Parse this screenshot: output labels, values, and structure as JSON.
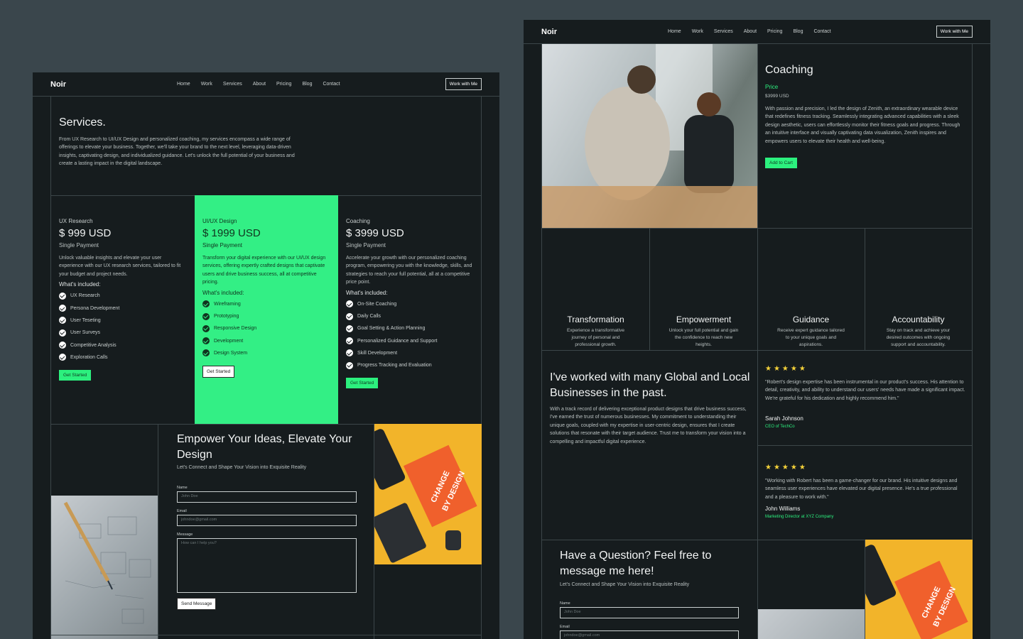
{
  "nav": {
    "logo": "Noir",
    "links": [
      "Home",
      "Work",
      "Services",
      "About",
      "Pricing",
      "Blog",
      "Contact"
    ],
    "cta": "Work with Me"
  },
  "services": {
    "title": "Services.",
    "intro": "From UX Research to UI/UX Design and personalized coaching, my services encompass a wide range of offerings to elevate your business. Together, we'll take your brand to the next level, leveraging data-driven insights, captivating design, and individualized guidance. Let's unlock the full potential of your business and create a lasting impact in the digital landscape.",
    "cards": [
      {
        "category": "UX Research",
        "price": "$ 999 USD",
        "payment": "Single Payment",
        "desc": "Unlock valuable insights and elevate your user experience with our UX research services, tailored to fit your budget and project needs.",
        "included": "What's included:",
        "items": [
          "UX Research",
          "Persona Development",
          "User Teseting",
          "User Surveys",
          "Competitive Analysis",
          "Exploration Calls"
        ],
        "button": "Get Started"
      },
      {
        "category": "UI/UX Design",
        "price": "$ 1999 USD",
        "payment": "Single Payment",
        "desc": "Transform your digital experience with our UI/UX design services, offering expertly crafted designs that captivate users and drive business success, all at competitive pricing.",
        "included": "What's included:",
        "items": [
          "Wireframing",
          "Prototyping",
          "Responsive Design",
          "Development",
          "Design System"
        ],
        "button": "Get Started"
      },
      {
        "category": "Coaching",
        "price": "$ 3999 USD",
        "payment": "Single Payment",
        "desc": "Accelerate your growth with our personalized coaching program, empowering you with the knowledge, skills, and strategies to reach your full potential, all at a competitive price point.",
        "included": "What's included:",
        "items": [
          "On-Site Coaching",
          "Daily Calls",
          "Goal Setting & Action Planning",
          "Personalized Guidance and Support",
          "Skill Development",
          "Progress Tracking and Evaluation"
        ],
        "button": "Get Started"
      }
    ]
  },
  "contact1": {
    "title": "Empower Your Ideas, Elevate Your Design",
    "subtitle": "Let's Connect and Shape Your Vision into Exquisite Reality",
    "name_label": "Name",
    "name_ph": "John Doe",
    "email_label": "Email",
    "email_ph": "johndoe@gmail.com",
    "msg_label": "Message",
    "msg_ph": "How can I help you?",
    "button": "Send Message"
  },
  "book_text": [
    "CHANGE",
    "BY DESIGN"
  ],
  "product": {
    "title": "Coaching",
    "price_label": "Price",
    "price": "$3999 USD",
    "desc": "With passion and precision, I led the design of Zenith, an extraordinary wearable device that redefines fitness tracking. Seamlessly integrating advanced capabilities with a sleek design aesthetic, users can effortlessly monitor their fitness goals and progress. Through an intuitive interface and visually captivating data visualization, Zenith inspires and empowers users to elevate their health and well-being.",
    "button": "Add to Cart"
  },
  "features": [
    {
      "title": "Transformation",
      "desc": "Experience a transformative journey of personal and professional growth."
    },
    {
      "title": "Empowerment",
      "desc": "Unlock your full potential and gain the confidence to reach new heights."
    },
    {
      "title": "Guidance",
      "desc": "Receive expert guidance tailored to your unique goals and aspirations."
    },
    {
      "title": "Accountability",
      "desc": "Stay on track and achieve your desired outcomes with ongoing support and accountability."
    }
  ],
  "about": {
    "title": "I've worked with many Global and Local Businesses in the past.",
    "desc": "With a track record of delivering exceptional product designs that drive business success, I've earned the trust of numerous businesses. My commitment to understanding their unique goals, coupled with my expertise in user-centric design, ensures that I create solutions that resonate with their target audience. Trust me to transform your vision into a compelling and impactful digital experience."
  },
  "testimonials": [
    {
      "stars": "★★★★★",
      "quote": "\"Robert's design expertise has been instrumental in our product's success. His attention to detail, creativity, and ability to understand our users' needs have made a significant impact. We're grateful for his dedication and highly recommend him.\"",
      "name": "Sarah Johnson",
      "role": "CEO of TechCo"
    },
    {
      "stars": "★★★★★",
      "quote": "\"Working with Robert has been a game-changer for our brand. His intuitive designs and seamless user experiences have elevated our digital presence. He's a true professional and a pleasure to work with.\"",
      "name": "John Williams",
      "role": "Marketing Director at XYZ Company"
    }
  ],
  "contact2": {
    "title": "Have a Question? Feel free to message me here!",
    "subtitle": "Let's Connect and Shape Your Vision into Exquisite Reality",
    "name_label": "Name",
    "name_ph": "John Doe",
    "email_label": "Email",
    "email_ph": "johndoe@gmail.com"
  }
}
